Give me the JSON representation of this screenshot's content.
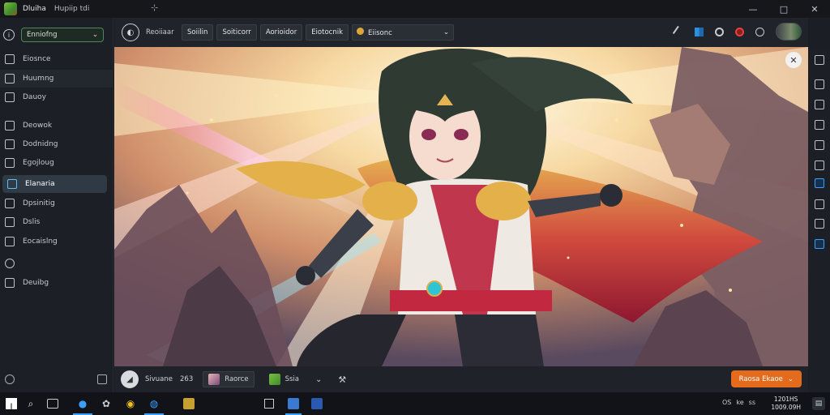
{
  "titlebar": {
    "app_name": "Dluiha",
    "subtitle": "Hupiip tdi",
    "pin_glyph": "⊹",
    "buttons": [
      {
        "name": "minimize-button",
        "glyph": "—"
      },
      {
        "name": "maximize-button",
        "glyph": "□"
      },
      {
        "name": "close-button",
        "glyph": "✕"
      }
    ]
  },
  "sidebar": {
    "select_label": "Enniofng",
    "select_chevron": "⌄",
    "items": [
      {
        "label": "Eiosnce",
        "icon": "document-icon"
      },
      {
        "label": "Huumng",
        "icon": "image-icon"
      },
      {
        "label": "Dauoy",
        "icon": "folder-icon"
      },
      {
        "label": "Deowok",
        "icon": "book-icon"
      },
      {
        "label": "Dodnidng",
        "icon": "layers-icon"
      },
      {
        "label": "Egojloug",
        "icon": "layers-icon"
      },
      {
        "label": "Elanaria",
        "icon": "palette-icon"
      },
      {
        "label": "Dpsinitig",
        "icon": "grid-icon"
      },
      {
        "label": "Dslis",
        "icon": "plus-icon"
      },
      {
        "label": "Eocaislng",
        "icon": "frame-icon"
      },
      {
        "label": "",
        "icon": "settings-icon"
      },
      {
        "label": "Deuibg",
        "icon": "list-icon"
      }
    ]
  },
  "toolbar": {
    "avatar_glyph": "◐",
    "label": "Reoiiaar",
    "buttons": [
      "Soiilin",
      "Soiticorr",
      "Aorioidor",
      "Eiotocnik"
    ],
    "dropdown_label": "Eiisonc",
    "dropdown_chevron": "⌄"
  },
  "canvas": {
    "close_glyph": "✕",
    "colors": {
      "glow": "#fff4d6",
      "cape": "#c61f3a",
      "gold": "#e3b04a",
      "hair": "#2f3a33"
    }
  },
  "bottombar": {
    "avatar_glyph": "◢",
    "name": "Sivuane",
    "count": "263",
    "tab1": "Raorce",
    "tab2": "Ssia",
    "chevron": "⌄",
    "wrench": "⚒",
    "action": "Raosa Ekaoe",
    "action_chevron": "⌄"
  },
  "taskbar": {
    "search_glyph": "⌕",
    "tray": [
      "OS",
      "ke",
      "ss"
    ],
    "time": "1201HS",
    "date": "1009.09H"
  }
}
